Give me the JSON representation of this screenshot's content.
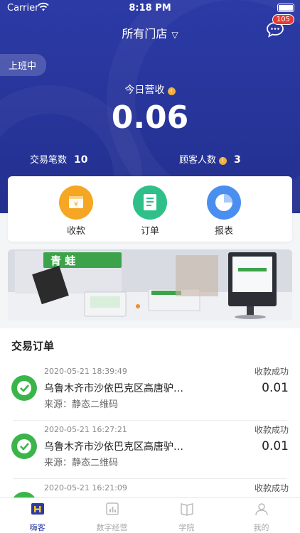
{
  "status_bar": {
    "carrier": "Carrier",
    "time": "8:18 PM"
  },
  "header": {
    "store_select": "所有门店",
    "message_badge": "105"
  },
  "duty_status": "上班中",
  "revenue": {
    "label": "今日营收",
    "value": "0.06"
  },
  "stats": [
    {
      "label": "交易笔数",
      "value": "10"
    },
    {
      "label": "顾客人数",
      "value": "3"
    }
  ],
  "quick_actions": [
    {
      "label": "收款",
      "icon": "wallet-icon",
      "color": "#f5a623"
    },
    {
      "label": "订单",
      "icon": "order-list-icon",
      "color": "#2fc08a"
    },
    {
      "label": "报表",
      "icon": "pie-chart-icon",
      "color": "#4a8ff0"
    }
  ],
  "banner": {
    "brand_text": "青 蛙"
  },
  "orders_section": {
    "title": "交易订单",
    "items": [
      {
        "time": "2020-05-21 18:39:49",
        "address": "乌鲁木齐市沙依巴克区高唐驴…",
        "source": "来源：静态二维码",
        "status": "收款成功",
        "amount": "0.01"
      },
      {
        "time": "2020-05-21 16:27:21",
        "address": "乌鲁木齐市沙依巴克区高唐驴…",
        "source": "来源：静态二维码",
        "status": "收款成功",
        "amount": "0.01"
      },
      {
        "time": "2020-05-21 16:21:09",
        "address": "",
        "source": "",
        "status": "收款成功",
        "amount": ""
      }
    ]
  },
  "tabbar": [
    {
      "label": "嗨客",
      "icon": "home-icon",
      "active": true
    },
    {
      "label": "数字经营",
      "icon": "bar-chart-icon",
      "active": false
    },
    {
      "label": "学院",
      "icon": "book-icon",
      "active": false
    },
    {
      "label": "我的",
      "icon": "user-icon",
      "active": false
    }
  ],
  "colors": {
    "brand": "#2c3aa6",
    "badge": "#e63a35",
    "wechat": "#3bb54a"
  }
}
